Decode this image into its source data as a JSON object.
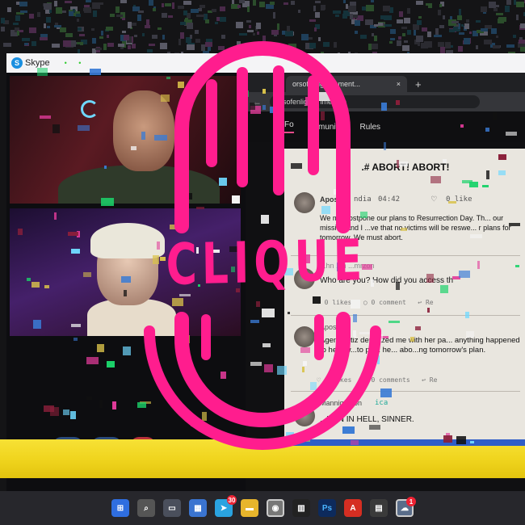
{
  "skype": {
    "logo_letter": "S",
    "title": "Skype"
  },
  "browser": {
    "tab_title": "orsofenlightenment...",
    "tab_close": "×",
    "new_tab": "+",
    "url": "orsofenlightenment.rp",
    "nav": {
      "forum": "Fo",
      "community": "mmunity",
      "rules": "Rules"
    }
  },
  "forum": {
    "thread_title": ".# ABORT! ABORT!",
    "posts": [
      {
        "author": "Apostl",
        "group": "ndia",
        "time": "04:42",
        "likes": "0 like",
        "body": "We m...postpone our plans to Resurrection Day. Th... our mission and I ...ve that no victims will be reswe... r plans for tomorrow. We must abort."
      },
      {
        "author": "...hn ...n ...mrzon",
        "body": "Who are you? How did you access th",
        "likes": "0 likes",
        "comments": "0 comment",
        "reply": "Re"
      },
      {
        "author": "Apostl",
        "body": "Agent Ortiz deputized me with her pa... anything happened to her i w...to po... he... abo...ng tomorrow's plan.",
        "likes": "0 likes",
        "comments": "0 comments",
        "reply": "Re"
      },
      {
        "author": "Mannigarzon",
        "group": "ica",
        "body": "...URN IN HELL, SINNER."
      }
    ]
  },
  "overlay": {
    "logo_text": "CLIQUE"
  },
  "taskbar": {
    "telegram_badge": "30",
    "skype_badge": "1",
    "photoshop_label": "Ps"
  },
  "colors": {
    "logo_pink": "#ff1d8e",
    "band_yellow": "#f0d51e",
    "taskbar": "#27272c"
  }
}
